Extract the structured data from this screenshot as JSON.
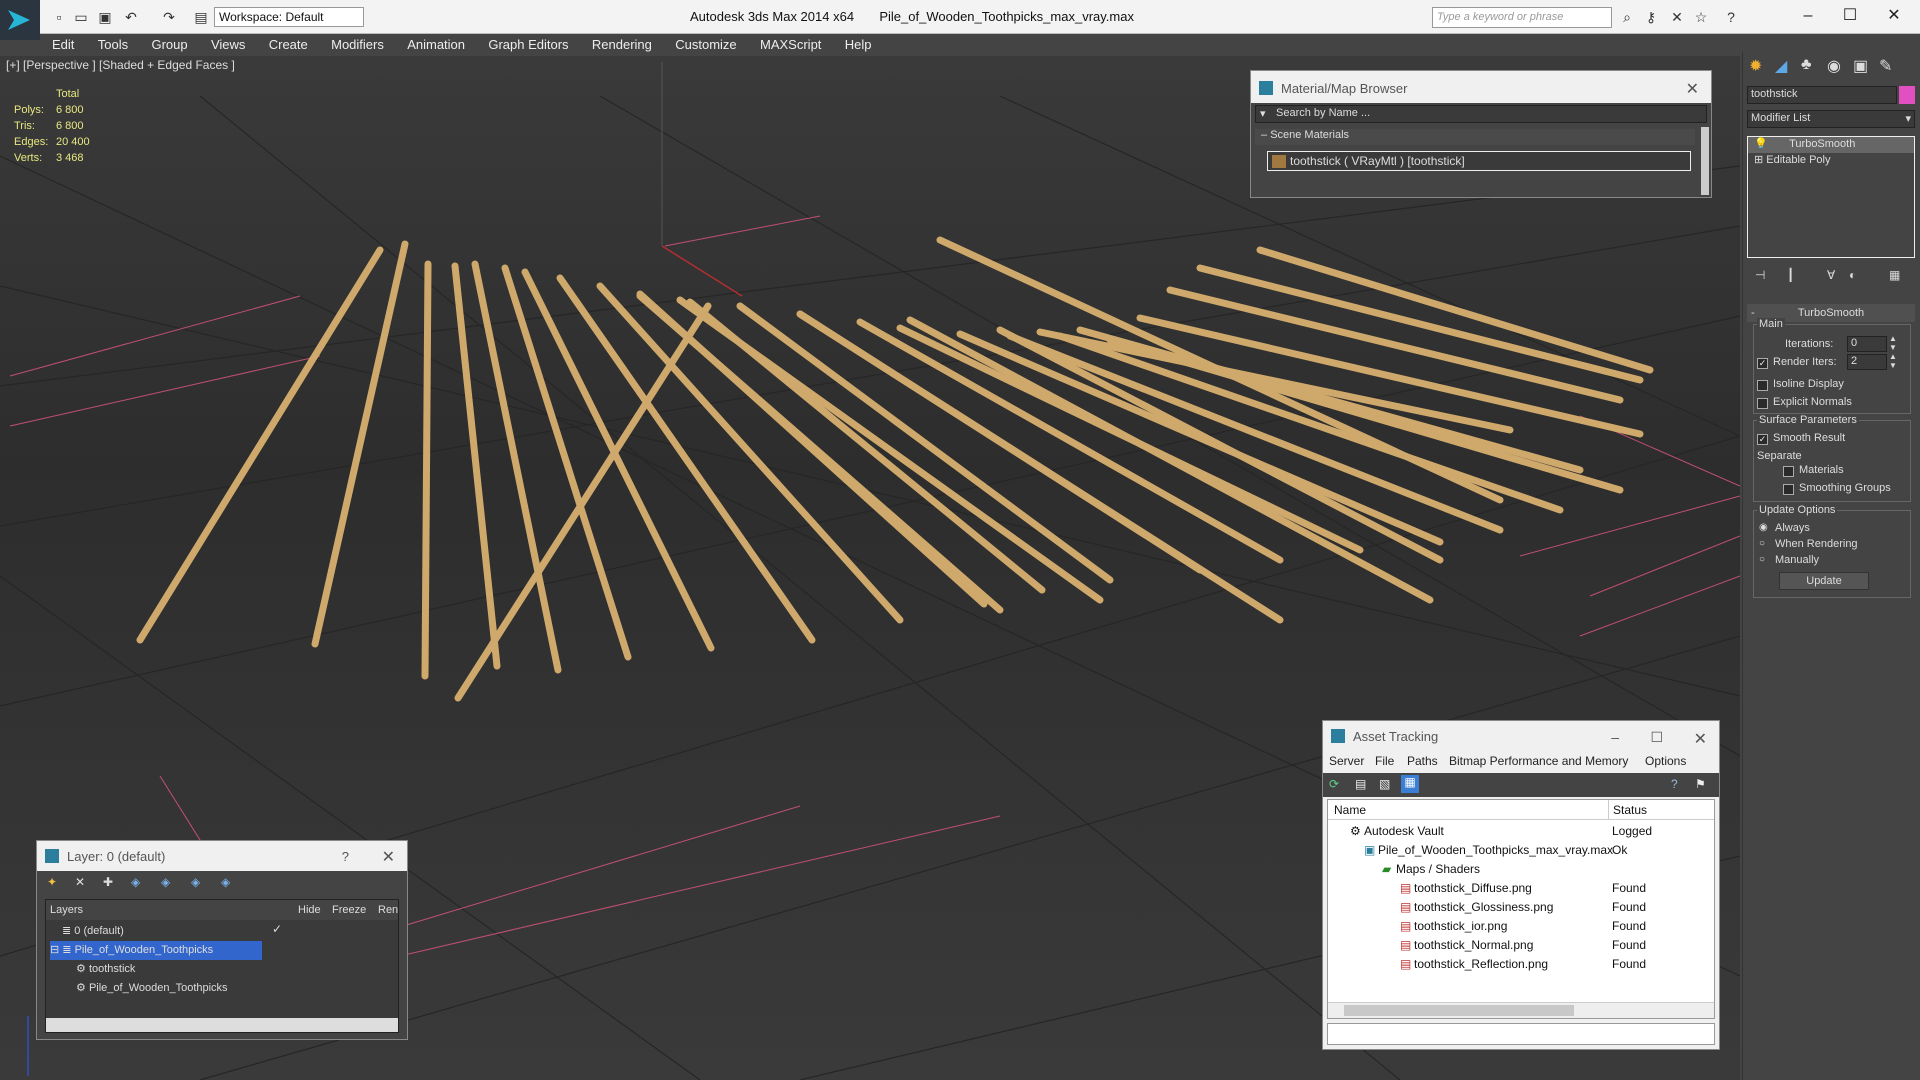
{
  "titlebar": {
    "app": "Autodesk 3ds Max  2014 x64",
    "file": "Pile_of_Wooden_Toothpicks_max_vray.max",
    "workspace": "Workspace: Default",
    "search_placeholder": "Type a keyword or phrase"
  },
  "menu": [
    "Edit",
    "Tools",
    "Group",
    "Views",
    "Create",
    "Modifiers",
    "Animation",
    "Graph Editors",
    "Rendering",
    "Customize",
    "MAXScript",
    "Help"
  ],
  "viewport": {
    "label": "[+] [Perspective ] [Shaded + Edged Faces ]",
    "stats": {
      "header": "Total",
      "rows": [
        {
          "label": "Polys:",
          "value": "6 800"
        },
        {
          "label": "Tris:",
          "value": "6 800"
        },
        {
          "label": "Edges:",
          "value": "20 400"
        },
        {
          "label": "Verts:",
          "value": "3 468"
        }
      ]
    }
  },
  "material_browser": {
    "title": "Material/Map Browser",
    "search": "Search by Name ...",
    "section": "Scene Materials",
    "item": "toothstick  ( VRayMtl ) [toothstick]"
  },
  "command_panel": {
    "object_name": "toothstick",
    "modifier_list": "Modifier List",
    "stack": [
      "TurboSmooth",
      "Editable Poly"
    ],
    "rollout_title": "TurboSmooth",
    "main_label": "Main",
    "iterations_label": "Iterations:",
    "iterations_value": "0",
    "render_iters_label": "Render Iters:",
    "render_iters_value": "2",
    "isoline": "Isoline Display",
    "explicit_normals": "Explicit Normals",
    "surface_params": "Surface Parameters",
    "smooth_result": "Smooth Result",
    "separate": "Separate",
    "materials": "Materials",
    "smoothing_groups": "Smoothing Groups",
    "update_options": "Update Options",
    "always": "Always",
    "when_rendering": "When Rendering",
    "manually": "Manually",
    "update_button": "Update"
  },
  "layer_panel": {
    "title": "Layer: 0 (default)",
    "help": "?",
    "columns": [
      "Layers",
      "Hide",
      "Freeze",
      "Ren"
    ],
    "rows": [
      {
        "name": "0 (default)"
      },
      {
        "name": "Pile_of_Wooden_Toothpicks"
      },
      {
        "name": "toothstick"
      },
      {
        "name": "Pile_of_Wooden_Toothpicks"
      }
    ]
  },
  "asset_tracking": {
    "title": "Asset Tracking",
    "menu": [
      "Server",
      "File",
      "Paths",
      "Bitmap Performance and Memory",
      "Options"
    ],
    "columns": [
      "Name",
      "Status"
    ],
    "rows": [
      {
        "name": "Autodesk Vault",
        "status": "Logged"
      },
      {
        "name": "Pile_of_Wooden_Toothpicks_max_vray.max",
        "status": "Ok"
      },
      {
        "name": "Maps / Shaders",
        "status": ""
      },
      {
        "name": "toothstick_Diffuse.png",
        "status": "Found"
      },
      {
        "name": "toothstick_Glossiness.png",
        "status": "Found"
      },
      {
        "name": "toothstick_ior.png",
        "status": "Found"
      },
      {
        "name": "toothstick_Normal.png",
        "status": "Found"
      },
      {
        "name": "toothstick_Reflection.png",
        "status": "Found"
      }
    ]
  },
  "colors": {
    "accent": "#3a7fd5",
    "toothpick": "#d8b070",
    "selection": "#3366cc"
  }
}
